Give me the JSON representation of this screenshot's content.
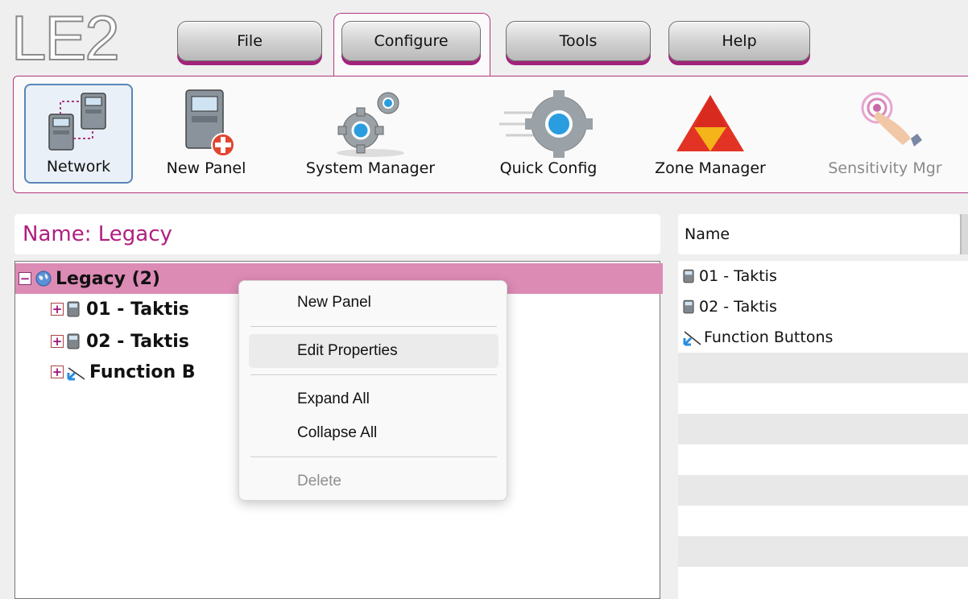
{
  "app": {
    "logo": "LE2"
  },
  "menu": [
    {
      "label": "File"
    },
    {
      "label": "Configure"
    },
    {
      "label": "Tools"
    },
    {
      "label": "Help"
    }
  ],
  "ribbon": [
    {
      "label": "Network",
      "icon": "network-icon"
    },
    {
      "label": "New Panel",
      "icon": "new-panel-icon"
    },
    {
      "label": "System Manager",
      "icon": "system-manager-gears-icon"
    },
    {
      "label": "Quick Config",
      "icon": "quick-config-gear-icon"
    },
    {
      "label": "Zone Manager",
      "icon": "zone-manager-triangle-icon"
    },
    {
      "label": "Sensitivity Mgr",
      "icon": "sensitivity-touch-icon"
    }
  ],
  "name_bar": {
    "text": "Name: Legacy"
  },
  "tree": {
    "root": "Legacy (2)",
    "children": [
      "01 - Taktis",
      "02 - Taktis",
      "Function B"
    ]
  },
  "list": {
    "header": "Name",
    "rows": [
      "01 - Taktis",
      "02 - Taktis",
      "Function Buttons"
    ]
  },
  "context_menu": {
    "items": [
      "New Panel",
      "Edit Properties",
      "Expand All",
      "Collapse All",
      "Delete"
    ]
  },
  "colors": {
    "accent": "#b2377f",
    "selection": "#dc8bb5",
    "name_text": "#b01f7e"
  }
}
